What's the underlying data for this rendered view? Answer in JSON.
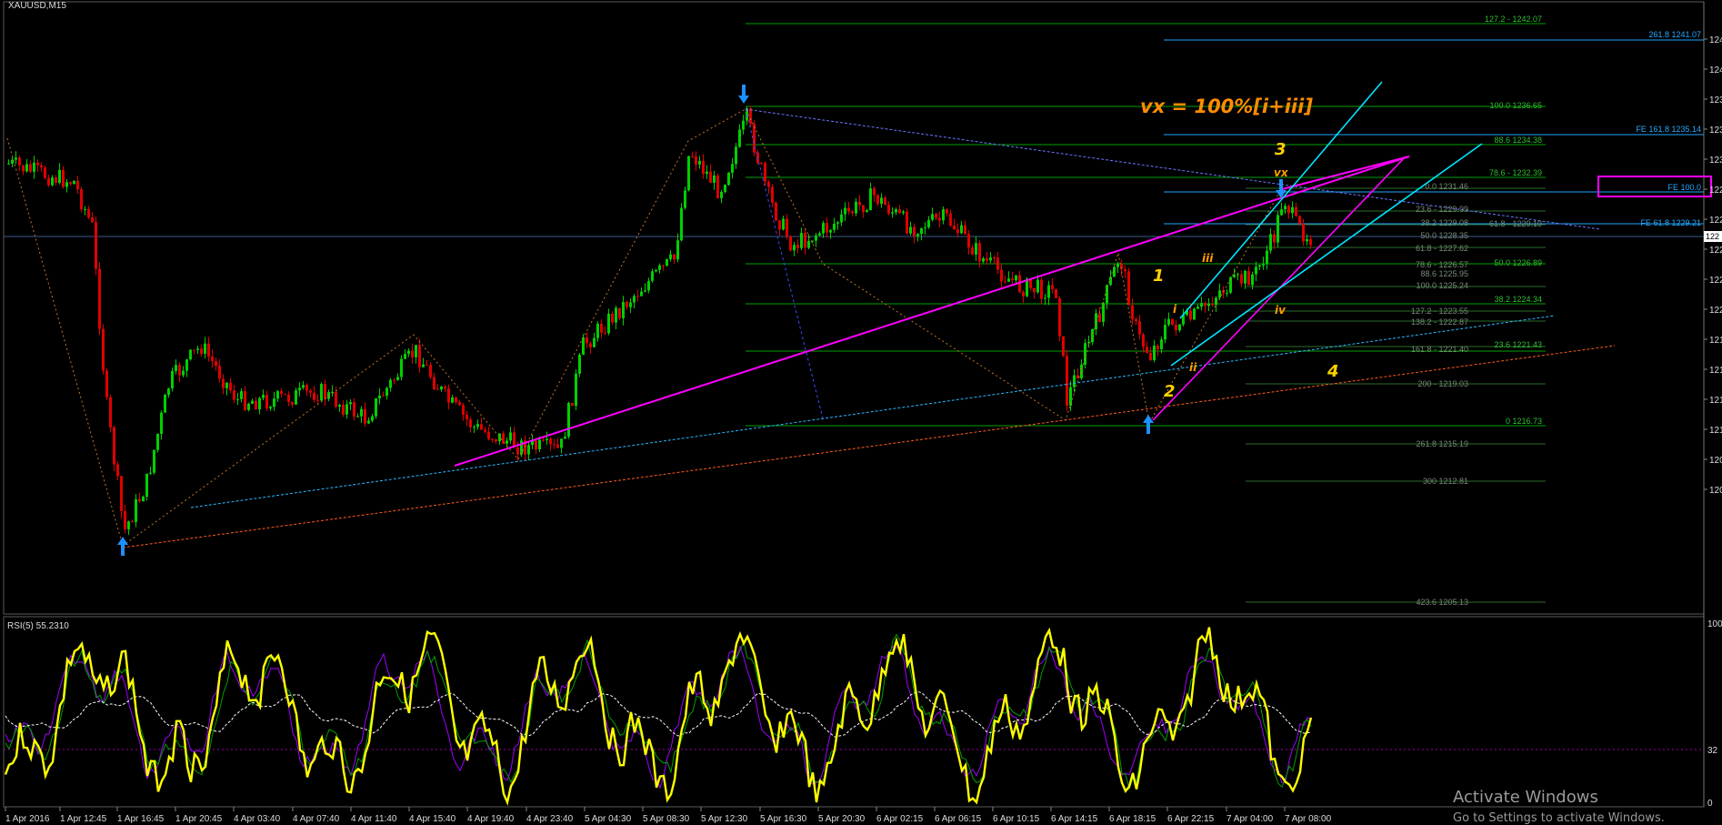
{
  "symbol_header": "XAUUSD,M15",
  "price_axis_labels": [
    "124",
    "124",
    "123",
    "123",
    "123",
    "122",
    "122",
    "122",
    "122",
    "122",
    "121",
    "121",
    "121",
    "121",
    "120",
    "120"
  ],
  "time_axis_labels": [
    "1 Apr 2016",
    "1 Apr 12:45",
    "1 Apr 16:45",
    "1 Apr 20:45",
    "4 Apr 03:40",
    "4 Apr 07:40",
    "4 Apr 11:40",
    "4 Apr 15:40",
    "4 Apr 19:40",
    "4 Apr 23:40",
    "5 Apr 04:30",
    "5 Apr 08:30",
    "5 Apr 12:30",
    "5 Apr 16:30",
    "5 Apr 20:30",
    "6 Apr 02:15",
    "6 Apr 06:15",
    "6 Apr 10:15",
    "6 Apr 14:15",
    "6 Apr 18:15",
    "6 Apr 22:15",
    "7 Apr 04:00",
    "7 Apr 08:00"
  ],
  "current_price_label": "122",
  "fib_levels_green": [
    "127.2 - 1242.07",
    "100.0 1236.65",
    "88.6 1234.38",
    "78.6 - 1232.39",
    "50.0 1226.89",
    "38.2 1224.34",
    "23.6 1221.43",
    "0 1216.73"
  ],
  "fib_levels_grey": [
    "0.0 1231.46",
    "23.6 - 1229.99",
    "38.2 1229.08",
    "50.0 1228.35",
    "61.8 - 1227.62",
    "78.6 - 1226.57",
    "88.6 1225.95",
    "100.0 1225.24",
    "127.2 - 1223.55",
    "138.2 - 1222.87",
    "161.8 - 1221.40",
    "200 - 1219.03",
    "261.8 1215.19",
    "300 1212.81",
    "423.6 1205.13",
    "61.8 - 1229.19"
  ],
  "fe_levels": [
    "261.8 1241.07",
    "FE 161.8 1235.14",
    "FE 100.0",
    "FE 61.8 1229.21"
  ],
  "annotation": "vx = 100%[i+iii]",
  "wave_labels": {
    "w1": "1",
    "w2": "2",
    "w3": "3",
    "w4": "4",
    "wi": "i",
    "wii": "ii",
    "wiii": "iii",
    "wiv": "iv",
    "wvx": "vx"
  },
  "rsi": {
    "label": "RSI(5) 55.2310",
    "level_high": "100",
    "level_mid": "32",
    "level_low": "0"
  },
  "watermark": {
    "line1": "Activate Windows",
    "line2": "Go to Settings to activate Windows."
  },
  "colors": {
    "bull": "#00d000",
    "bear": "#e00000",
    "magenta": "#ff00ff",
    "cyan": "#00e5ff",
    "fib_green": "#00a000",
    "rsi": "#ffff00",
    "blue_arrow": "#1e90ff"
  }
}
